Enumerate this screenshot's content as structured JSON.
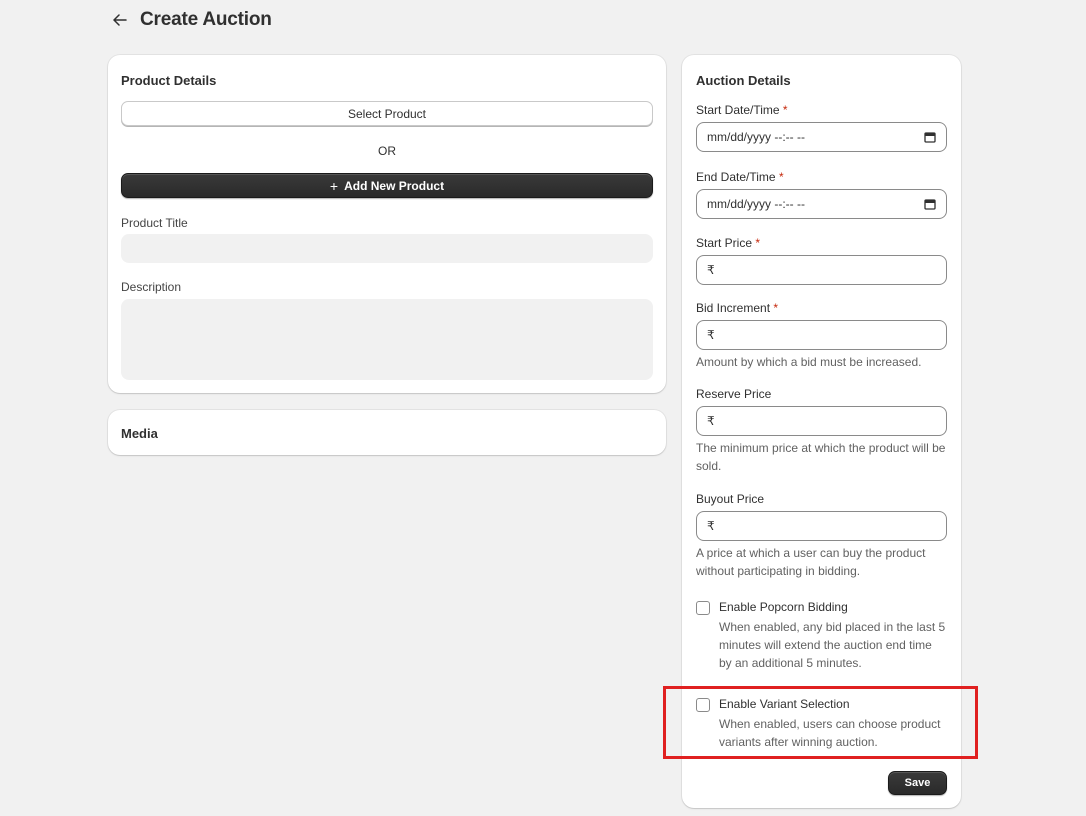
{
  "header": {
    "title": "Create Auction",
    "back_icon": "arrow-left-icon"
  },
  "product_details": {
    "title": "Product Details",
    "select_product_label": "Select Product",
    "or_text": "OR",
    "add_new_product_label": "Add New Product",
    "product_title_label": "Product Title",
    "product_title_value": "",
    "description_label": "Description",
    "description_value": ""
  },
  "media": {
    "title": "Media"
  },
  "auction_details": {
    "title": "Auction Details",
    "required_mark": "*",
    "start_datetime": {
      "label": "Start Date/Time",
      "placeholder": "mm/dd/yyyy --:-- --"
    },
    "end_datetime": {
      "label": "End Date/Time",
      "placeholder": "mm/dd/yyyy --:-- --"
    },
    "start_price": {
      "label": "Start Price",
      "prefix": "₹",
      "value": ""
    },
    "bid_increment": {
      "label": "Bid Increment",
      "prefix": "₹",
      "value": "",
      "help": "Amount by which a bid must be increased."
    },
    "reserve_price": {
      "label": "Reserve Price",
      "prefix": "₹",
      "value": "",
      "help": "The minimum price at which the product will be sold."
    },
    "buyout_price": {
      "label": "Buyout Price",
      "prefix": "₹",
      "value": "",
      "help": "A price at which a user can buy the product without participating in bidding."
    },
    "popcorn_bidding": {
      "label": "Enable Popcorn Bidding",
      "checked": false,
      "help": "When enabled, any bid placed in the last 5 minutes will extend the auction end time by an additional 5 minutes."
    },
    "variant_selection": {
      "label": "Enable Variant Selection",
      "checked": false,
      "help": "When enabled, users can choose product variants after winning auction."
    },
    "save_label": "Save"
  },
  "colors": {
    "primary_button": "#303030",
    "highlight": "#e02020",
    "required": "#c5280c",
    "background": "#f1f1f1"
  }
}
